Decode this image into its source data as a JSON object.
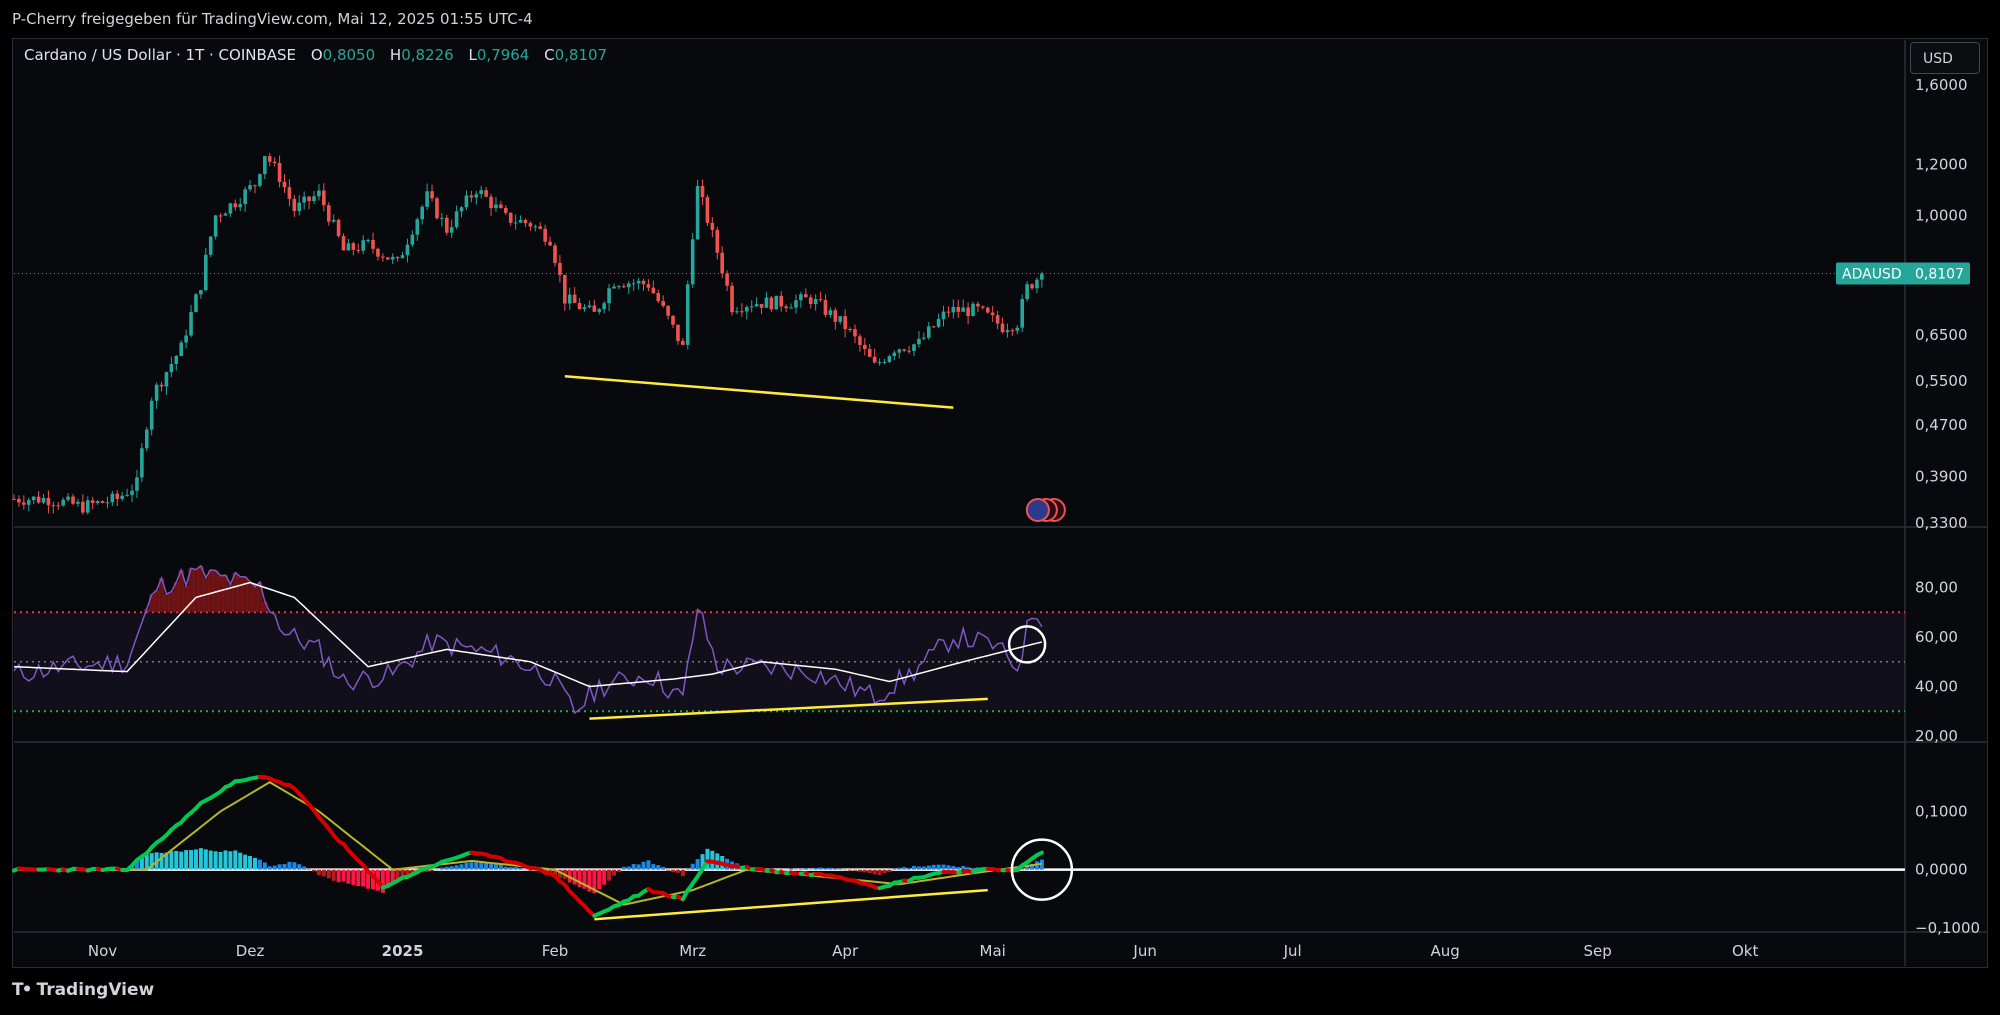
{
  "header": {
    "publisher_text": "P-Cherry freigegeben für TradingView.com, Mai 12, 2025 01:55 UTC-4"
  },
  "symbol_bar": {
    "name": "Cardano / US Dollar · 1T · COINBASE",
    "open_label": "O",
    "open": "0,8050",
    "high_label": "H",
    "high": "0,8226",
    "low_label": "L",
    "low": "0,7964",
    "close_label": "C",
    "close": "0,8107"
  },
  "currency_button": "USD",
  "price_tag": {
    "symbol": "ADAUSD",
    "value": "0,8107"
  },
  "branding": {
    "name": "TradingView"
  },
  "colors": {
    "up": "#26a69a",
    "down": "#ef5350",
    "trendline": "#ffeb3b",
    "rsi": "#7e57c2",
    "rsi_ma": "#ffffff",
    "macd_up": "#00c853",
    "macd_down": "#d50000",
    "signal": "#b5b52a"
  },
  "chart_data": [
    {
      "type": "candlestick",
      "name": "price",
      "scale": "log",
      "ylim": [
        0.33,
        1.75
      ],
      "y_ticks": [
        "1,6000",
        "1,2000",
        "1,0000",
        "0,6500",
        "0,5500",
        "0,4700",
        "0,3900",
        "0,3300"
      ],
      "y_tick_values": [
        1.6,
        1.2,
        1.0,
        0.65,
        0.55,
        0.47,
        0.39,
        0.33
      ],
      "x_ticks": [
        "Nov",
        "Dez",
        "2025",
        "Feb",
        "Mrz",
        "Apr",
        "Mai",
        "Jun",
        "Jul",
        "Aug",
        "Sep",
        "Okt"
      ],
      "close_anchors": [
        [
          "2024-10-14",
          0.36
        ],
        [
          "2024-10-21",
          0.36
        ],
        [
          "2024-10-28",
          0.35
        ],
        [
          "2024-11-04",
          0.36
        ],
        [
          "2024-11-08",
          0.38
        ],
        [
          "2024-11-11",
          0.52
        ],
        [
          "2024-11-14",
          0.57
        ],
        [
          "2024-11-17",
          0.62
        ],
        [
          "2024-11-21",
          0.78
        ],
        [
          "2024-11-24",
          1.0
        ],
        [
          "2024-11-28",
          1.05
        ],
        [
          "2024-12-02",
          1.12
        ],
        [
          "2024-12-04",
          1.25
        ],
        [
          "2024-12-07",
          1.15
        ],
        [
          "2024-12-10",
          1.02
        ],
        [
          "2024-12-15",
          1.08
        ],
        [
          "2024-12-20",
          0.88
        ],
        [
          "2024-12-25",
          0.9
        ],
        [
          "2024-12-31",
          0.84
        ],
        [
          "2025-01-06",
          1.07
        ],
        [
          "2025-01-10",
          0.95
        ],
        [
          "2025-01-16",
          1.1
        ],
        [
          "2025-01-22",
          0.99
        ],
        [
          "2025-01-27",
          0.97
        ],
        [
          "2025-01-31",
          0.92
        ],
        [
          "2025-02-03",
          0.74
        ],
        [
          "2025-02-09",
          0.7
        ],
        [
          "2025-02-13",
          0.79
        ],
        [
          "2025-02-20",
          0.78
        ],
        [
          "2025-02-27",
          0.62
        ],
        [
          "2025-03-02",
          1.1
        ],
        [
          "2025-03-05",
          0.93
        ],
        [
          "2025-03-09",
          0.72
        ],
        [
          "2025-03-13",
          0.73
        ],
        [
          "2025-03-20",
          0.73
        ],
        [
          "2025-03-25",
          0.74
        ],
        [
          "2025-04-01",
          0.67
        ],
        [
          "2025-04-07",
          0.58
        ],
        [
          "2025-04-11",
          0.62
        ],
        [
          "2025-04-16",
          0.63
        ],
        [
          "2025-04-22",
          0.71
        ],
        [
          "2025-04-28",
          0.71
        ],
        [
          "2025-05-03",
          0.67
        ],
        [
          "2025-05-06",
          0.68
        ],
        [
          "2025-05-08",
          0.77
        ],
        [
          "2025-05-11",
          0.8107
        ]
      ],
      "trendline": [
        [
          "2025-02-03",
          0.56
        ],
        [
          "2025-04-23",
          0.5
        ]
      ],
      "last_price": 0.8107
    },
    {
      "type": "line",
      "name": "RSI",
      "ylim": [
        20,
        100
      ],
      "y_ticks": [
        "80,00",
        "60,00",
        "40,00",
        "20,00"
      ],
      "y_tick_values": [
        80,
        60,
        40,
        20
      ],
      "overbought": 70,
      "middle": 50,
      "oversold": 30,
      "rsi_anchors": [
        [
          "2024-10-14",
          45
        ],
        [
          "2024-10-25",
          48
        ],
        [
          "2024-11-06",
          50
        ],
        [
          "2024-11-12",
          80
        ],
        [
          "2024-11-20",
          86
        ],
        [
          "2024-11-27",
          83
        ],
        [
          "2024-12-03",
          80
        ],
        [
          "2024-12-08",
          62
        ],
        [
          "2024-12-15",
          55
        ],
        [
          "2024-12-20",
          42
        ],
        [
          "2024-12-30",
          45
        ],
        [
          "2025-01-07",
          58
        ],
        [
          "2025-01-15",
          55
        ],
        [
          "2025-01-22",
          52
        ],
        [
          "2025-01-31",
          44
        ],
        [
          "2025-02-05",
          30
        ],
        [
          "2025-02-10",
          40
        ],
        [
          "2025-02-20",
          45
        ],
        [
          "2025-02-27",
          35
        ],
        [
          "2025-03-02",
          72
        ],
        [
          "2025-03-06",
          48
        ],
        [
          "2025-03-15",
          48
        ],
        [
          "2025-03-25",
          46
        ],
        [
          "2025-04-07",
          36
        ],
        [
          "2025-04-15",
          46
        ],
        [
          "2025-04-23",
          60
        ],
        [
          "2025-05-01",
          57
        ],
        [
          "2025-05-06",
          48
        ],
        [
          "2025-05-09",
          70
        ],
        [
          "2025-05-11",
          68
        ]
      ],
      "ma_anchors": [
        [
          "2024-10-14",
          48
        ],
        [
          "2024-11-06",
          46
        ],
        [
          "2024-11-20",
          76
        ],
        [
          "2024-12-01",
          82
        ],
        [
          "2024-12-10",
          76
        ],
        [
          "2024-12-25",
          48
        ],
        [
          "2025-01-10",
          55
        ],
        [
          "2025-01-27",
          50
        ],
        [
          "2025-02-08",
          40
        ],
        [
          "2025-02-25",
          43
        ],
        [
          "2025-03-05",
          45
        ],
        [
          "2025-03-15",
          50
        ],
        [
          "2025-03-30",
          47
        ],
        [
          "2025-04-10",
          42
        ],
        [
          "2025-04-25",
          50
        ],
        [
          "2025-05-11",
          58
        ]
      ],
      "trendline": [
        [
          "2025-02-08",
          27
        ],
        [
          "2025-04-30",
          35
        ]
      ]
    },
    {
      "type": "line",
      "name": "MACD",
      "ylim": [
        -0.1,
        0.2
      ],
      "y_ticks": [
        "0,1000",
        "0,0000",
        "−0,1000"
      ],
      "y_tick_values": [
        0.1,
        0,
        -0.1
      ],
      "macd_anchors": [
        [
          "2024-10-14",
          0.0
        ],
        [
          "2024-11-06",
          0.0
        ],
        [
          "2024-11-14",
          0.06
        ],
        [
          "2024-11-22",
          0.12
        ],
        [
          "2024-11-28",
          0.15
        ],
        [
          "2024-12-04",
          0.16
        ],
        [
          "2024-12-10",
          0.14
        ],
        [
          "2024-12-18",
          0.06
        ],
        [
          "2024-12-28",
          -0.03
        ],
        [
          "2025-01-05",
          0.0
        ],
        [
          "2025-01-15",
          0.03
        ],
        [
          "2025-01-25",
          0.01
        ],
        [
          "2025-02-01",
          -0.01
        ],
        [
          "2025-02-09",
          -0.08
        ],
        [
          "2025-02-20",
          -0.035
        ],
        [
          "2025-02-27",
          -0.05
        ],
        [
          "2025-03-04",
          0.015
        ],
        [
          "2025-03-10",
          0.005
        ],
        [
          "2025-03-20",
          -0.005
        ],
        [
          "2025-03-30",
          -0.01
        ],
        [
          "2025-04-08",
          -0.03
        ],
        [
          "2025-04-20",
          -0.005
        ],
        [
          "2025-05-01",
          0.0
        ],
        [
          "2025-05-06",
          0.0
        ],
        [
          "2025-05-11",
          0.03
        ]
      ],
      "signal_anchors": [
        [
          "2024-10-14",
          0.0
        ],
        [
          "2024-11-10",
          0.0
        ],
        [
          "2024-11-25",
          0.1
        ],
        [
          "2024-12-05",
          0.15
        ],
        [
          "2024-12-15",
          0.1
        ],
        [
          "2024-12-30",
          0.0
        ],
        [
          "2025-01-15",
          0.015
        ],
        [
          "2025-02-01",
          0.0
        ],
        [
          "2025-02-15",
          -0.06
        ],
        [
          "2025-03-01",
          -0.035
        ],
        [
          "2025-03-12",
          0.0
        ],
        [
          "2025-03-25",
          -0.01
        ],
        [
          "2025-04-12",
          -0.025
        ],
        [
          "2025-04-28",
          -0.005
        ],
        [
          "2025-05-11",
          0.01
        ]
      ],
      "trendline": [
        [
          "2025-02-09",
          -0.085
        ],
        [
          "2025-04-30",
          -0.035
        ]
      ]
    }
  ]
}
